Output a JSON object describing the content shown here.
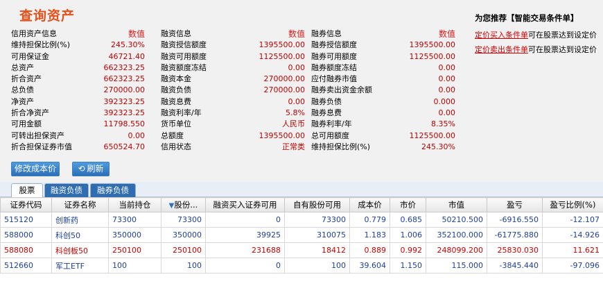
{
  "title": "查询资产",
  "col1": {
    "header": {
      "label": "信用资产信息",
      "value": "数值"
    },
    "rows": [
      {
        "label": "维持担保比例(%)",
        "value": "245.30%"
      },
      {
        "label": "可用保证金",
        "value": "46721.40"
      },
      {
        "label": "总资产",
        "value": "662323.25"
      },
      {
        "label": "折合资产",
        "value": "662323.25"
      },
      {
        "label": "总负债",
        "value": "270000.00"
      },
      {
        "label": "净资产",
        "value": "392323.25"
      },
      {
        "label": "折合净资产",
        "value": "392323.25"
      },
      {
        "label": "可用金额",
        "value": "11798.550"
      },
      {
        "label": "可转出担保资产",
        "value": "0.00"
      },
      {
        "label": "折合担保证券市值",
        "value": "650524.70"
      }
    ]
  },
  "col2": {
    "header": {
      "label": "融资信息",
      "value": "数值"
    },
    "rows": [
      {
        "label": "融资授信额度",
        "value": "1395500.00"
      },
      {
        "label": "融资可用额度",
        "value": "1125500.00"
      },
      {
        "label": "融资额度冻结",
        "value": "0.00"
      },
      {
        "label": "融资本金",
        "value": "270000.00"
      },
      {
        "label": "融资负债",
        "value": "270000.00"
      },
      {
        "label": "融资息费",
        "value": "0.00"
      },
      {
        "label": "融资利率/年",
        "value": "5.8%"
      },
      {
        "label": "货币单位",
        "value": "人民币"
      },
      {
        "label": "总额度",
        "value": "1395500.00"
      },
      {
        "label": "信用状态",
        "value": "正常类"
      }
    ]
  },
  "col3": {
    "header": {
      "label": "融券信息",
      "value": "数值"
    },
    "rows": [
      {
        "label": "融券授信额度",
        "value": "1395500.00"
      },
      {
        "label": "融券可用额度",
        "value": "1125500.00"
      },
      {
        "label": "融券额度冻结",
        "value": "0.00"
      },
      {
        "label": "应付融券市值",
        "value": "0.00"
      },
      {
        "label": "融券卖出资金余额",
        "value": "0.00"
      },
      {
        "label": "融券负债",
        "value": "0.000"
      },
      {
        "label": "融券息费",
        "value": "0.00"
      },
      {
        "label": "融券利率/年",
        "value": "8.35%"
      },
      {
        "label": "总可用额度",
        "value": "1125500.00"
      },
      {
        "label": "维持担保比例(%)",
        "value": "245.30%"
      }
    ]
  },
  "recommend": {
    "title": "为您推荐【智能交易条件单】",
    "lines": [
      {
        "link": "定价买入条件单",
        "text": "可在股票达到设定价"
      },
      {
        "link": "定价卖出条件单",
        "text": "可在股票达到设定价"
      }
    ]
  },
  "buttons": {
    "edit_cost": "修改成本价",
    "refresh": "刷新"
  },
  "tabs": [
    "股票",
    "融资负债",
    "融券负债"
  ],
  "table": {
    "headers": [
      "证券代码",
      "证券名称",
      "当前持仓",
      "股份...",
      "融资买入证券可用",
      "自有股份可用",
      "成本价",
      "市价",
      "市值",
      "盈亏",
      "盈亏比例(%)"
    ],
    "sort_arrow": "▼",
    "rows": [
      {
        "color": "blue",
        "cells": [
          "515120",
          "创新药",
          "73300",
          "73300",
          "0",
          "73300",
          "0.779",
          "0.685",
          "50210.500",
          "-6916.550",
          "-12.107"
        ]
      },
      {
        "color": "blue",
        "cells": [
          "588000",
          "科创50",
          "350000",
          "350000",
          "39925",
          "310075",
          "1.183",
          "1.006",
          "352100.000",
          "-61775.880",
          "-14.926"
        ]
      },
      {
        "color": "red",
        "cells": [
          "588080",
          "科创板50",
          "250100",
          "250100",
          "231688",
          "18412",
          "0.889",
          "0.992",
          "248099.200",
          "25830.030",
          "11.621"
        ]
      },
      {
        "color": "blue",
        "cells": [
          "512660",
          "军工ETF",
          "100",
          "100",
          "0",
          "100",
          "39.604",
          "1.150",
          "115.000",
          "-3845.440",
          "-97.096"
        ]
      }
    ]
  },
  "colors": {
    "title": "#e8501a",
    "value_red": "#c00000",
    "row_blue": "#1f3f9a",
    "row_red": "#d00000",
    "button_blue": "#2d6fb6"
  }
}
